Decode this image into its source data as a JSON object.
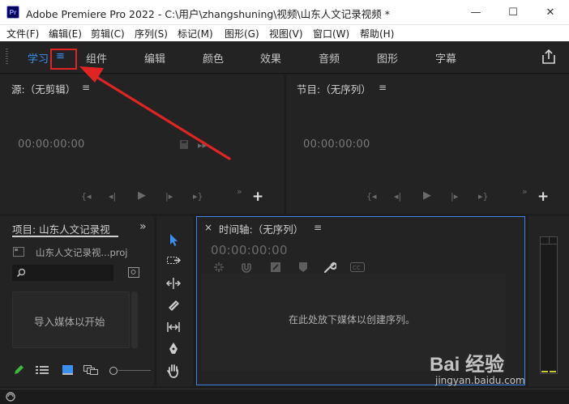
{
  "window": {
    "app_icon_text": "Pr",
    "title": "Adobe Premiere Pro 2022 - C:\\用户\\zhangshuning\\视频\\山东人文记录视频 *",
    "minimize_glyph": "—",
    "maximize_glyph": "☐",
    "close_glyph": "✕"
  },
  "menubar": {
    "items": [
      "文件(F)",
      "编辑(E)",
      "剪辑(C)",
      "序列(S)",
      "标记(M)",
      "图形(G)",
      "视图(V)",
      "窗口(W)",
      "帮助(H)"
    ]
  },
  "workspace": {
    "active_tab": "学习",
    "menu_glyph": "≡",
    "tabs": [
      "组件",
      "编辑",
      "颜色",
      "效果",
      "音频",
      "图形",
      "字幕"
    ],
    "share_icon": "share-icon"
  },
  "source_panel": {
    "title": "源:（无剪辑）",
    "menu_glyph": "≡",
    "timecode": "00:00:00:00",
    "add_glyph": "+"
  },
  "program_panel": {
    "title": "节目:（无序列）",
    "menu_glyph": "≡",
    "timecode": "00:00:00:00",
    "add_glyph": "+"
  },
  "project_panel": {
    "title": "项目: 山东人文记录视",
    "expand_glyph": "»",
    "file_name": "山东人文记录视...proj",
    "import_hint": "导入媒体以开始"
  },
  "timeline_panel": {
    "close_glyph": "×",
    "title": "时间轴:（无序列）",
    "menu_glyph": "≡",
    "timecode": "00:00:00:00",
    "drop_hint": "在此处放下媒体以创建序列。"
  },
  "watermark": {
    "brand": "Bai 经验",
    "url": "jingyan.baidu.com"
  },
  "colors": {
    "accent_blue": "#3b8ff0",
    "annotation_red": "#e02424",
    "panel_bg": "#232323"
  }
}
